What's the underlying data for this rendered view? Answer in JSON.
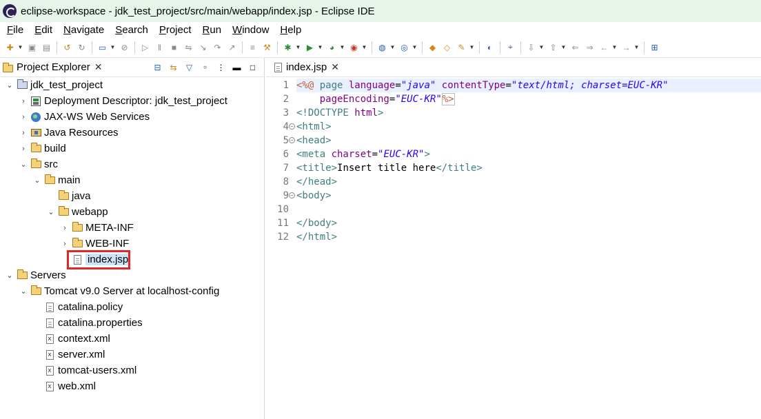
{
  "window": {
    "title": "eclipse-workspace - jdk_test_project/src/main/webapp/index.jsp - Eclipse IDE"
  },
  "menu": [
    {
      "mnemonic": "F",
      "rest": "ile"
    },
    {
      "mnemonic": "E",
      "rest": "dit"
    },
    {
      "mnemonic": "N",
      "rest": "avigate"
    },
    {
      "mnemonic": "S",
      "rest": "earch",
      "prefix": ""
    },
    {
      "mnemonic": "P",
      "rest": "roject"
    },
    {
      "mnemonic": "R",
      "rest": "un"
    },
    {
      "mnemonic": "W",
      "rest": "indow"
    },
    {
      "mnemonic": "H",
      "rest": "elp"
    }
  ],
  "project_explorer": {
    "tab_label": "Project Explorer",
    "tree": [
      {
        "label": "jdk_test_project",
        "icon": "project-icon",
        "expanded": true
      },
      {
        "label": "Deployment Descriptor: jdk_test_project",
        "icon": "deployment-descriptor-icon",
        "expanded": false
      },
      {
        "label": "JAX-WS Web Services",
        "icon": "jaxws-icon",
        "expanded": false
      },
      {
        "label": "Java Resources",
        "icon": "java-resources-icon",
        "expanded": false
      },
      {
        "label": "build",
        "icon": "folder-icon",
        "expanded": false
      },
      {
        "label": "src",
        "icon": "folder-icon",
        "expanded": true
      },
      {
        "label": "main",
        "icon": "folder-icon",
        "expanded": true
      },
      {
        "label": "java",
        "icon": "folder-icon",
        "expanded": null
      },
      {
        "label": "webapp",
        "icon": "folder-icon",
        "expanded": true
      },
      {
        "label": "META-INF",
        "icon": "folder-icon",
        "expanded": false
      },
      {
        "label": "WEB-INF",
        "icon": "folder-icon",
        "expanded": false
      },
      {
        "label": "index.jsp",
        "icon": "jsp-file-icon",
        "expanded": null,
        "selected": true
      },
      {
        "label": "Servers",
        "icon": "servers-folder-icon",
        "expanded": true
      },
      {
        "label": "Tomcat v9.0 Server at localhost-config",
        "icon": "folder-icon",
        "expanded": true
      },
      {
        "label": "catalina.policy",
        "icon": "file-icon",
        "expanded": null
      },
      {
        "label": "catalina.properties",
        "icon": "file-icon",
        "expanded": null
      },
      {
        "label": "context.xml",
        "icon": "xml-file-icon",
        "expanded": null
      },
      {
        "label": "server.xml",
        "icon": "xml-file-icon",
        "expanded": null
      },
      {
        "label": "tomcat-users.xml",
        "icon": "xml-file-icon",
        "expanded": null
      },
      {
        "label": "web.xml",
        "icon": "xml-file-icon",
        "expanded": null
      }
    ]
  },
  "editor": {
    "tab_label": "index.jsp",
    "line_numbers": [
      "1",
      "2",
      "3",
      "4",
      "5",
      "6",
      "7",
      "8",
      "9",
      "10",
      "11",
      "12"
    ],
    "lines": [
      [
        {
          "t": "<%@ ",
          "c": "dir"
        },
        {
          "t": "page ",
          "c": "tag"
        },
        {
          "t": "language",
          "c": "attr"
        },
        {
          "t": "=",
          "c": "text"
        },
        {
          "t": "\"java\"",
          "c": "str"
        },
        {
          "t": " ",
          "c": "text"
        },
        {
          "t": "contentType",
          "c": "attr"
        },
        {
          "t": "=",
          "c": "text"
        },
        {
          "t": "\"text/html; charset=EUC-KR\"",
          "c": "str"
        }
      ],
      [
        {
          "t": "    ",
          "c": "text"
        },
        {
          "t": "pageEncoding",
          "c": "attr"
        },
        {
          "t": "=",
          "c": "text"
        },
        {
          "t": "\"EUC-KR\"",
          "c": "str"
        },
        {
          "t": "%>",
          "c": "dirbox"
        }
      ],
      [
        {
          "t": "<!DOCTYPE ",
          "c": "tag"
        },
        {
          "t": "html",
          "c": "attr"
        },
        {
          "t": ">",
          "c": "tag"
        }
      ],
      [
        {
          "t": "<html>",
          "c": "tag"
        }
      ],
      [
        {
          "t": "<head>",
          "c": "tag"
        }
      ],
      [
        {
          "t": "<meta ",
          "c": "tag"
        },
        {
          "t": "charset",
          "c": "attr"
        },
        {
          "t": "=",
          "c": "text"
        },
        {
          "t": "\"EUC-KR\"",
          "c": "str"
        },
        {
          "t": ">",
          "c": "tag"
        }
      ],
      [
        {
          "t": "<title>",
          "c": "tag"
        },
        {
          "t": "Insert title here",
          "c": "text"
        },
        {
          "t": "</title>",
          "c": "tag"
        }
      ],
      [
        {
          "t": "</head>",
          "c": "tag"
        }
      ],
      [
        {
          "t": "<body>",
          "c": "tag"
        }
      ],
      [
        {
          "t": "",
          "c": "text"
        }
      ],
      [
        {
          "t": "</body>",
          "c": "tag"
        }
      ],
      [
        {
          "t": "</html>",
          "c": "tag"
        }
      ]
    ],
    "fold_markers": [
      "4",
      "5",
      "9"
    ]
  },
  "colors": {
    "selection_border": "#e32626",
    "title_bar": "#e6f4ea"
  }
}
